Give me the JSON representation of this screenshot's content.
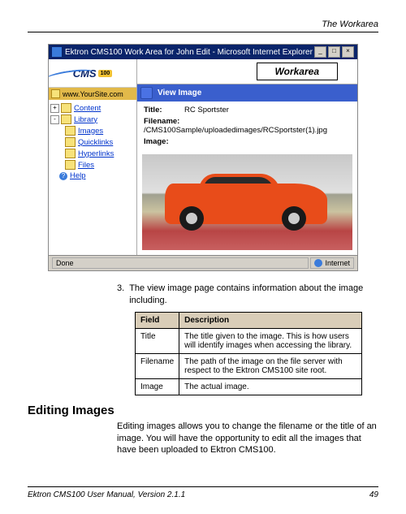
{
  "header": {
    "running": "The Workarea"
  },
  "browser": {
    "title": "Ektron CMS100 Work Area for John Edit - Microsoft Internet Explorer",
    "min": "_",
    "max": "□",
    "close": "×",
    "logo_text": "CMS",
    "logo_badge": "100",
    "site_label": "www.YourSite.com",
    "tree": {
      "content": "Content",
      "library": "Library",
      "images": "Images",
      "quicklinks": "Quicklinks",
      "hyperlinks": "Hyperlinks",
      "files": "Files",
      "help": "Help"
    },
    "workarea_label": "Workarea",
    "viewbar": "View Image",
    "details": {
      "title_label": "Title:",
      "title_value": "RC Sportster",
      "filename_label": "Filename:",
      "filename_value": "/CMS100Sample/uploadedimages/RCSportster(1).jpg",
      "image_label": "Image:"
    },
    "status_done": "Done",
    "status_zone": "Internet"
  },
  "step": {
    "num": "3.",
    "text": "The view image page contains information about the image including."
  },
  "table": {
    "h1": "Field",
    "h2": "Description",
    "rows": [
      {
        "f": "Title",
        "d": "The title given to the image. This is how users will identify images when accessing the library."
      },
      {
        "f": "Filename",
        "d": "The path of the image on the file server with respect to the Ektron CMS100 site root."
      },
      {
        "f": "Image",
        "d": "The actual image."
      }
    ]
  },
  "section": {
    "heading": "Editing Images",
    "body": "Editing images allows you to change the filename or the title of an image.  You will have the opportunity to edit all the images that have been uploaded to Ektron CMS100."
  },
  "footer": {
    "left": "Ektron CMS100 User Manual, Version 2.1.1",
    "right": "49"
  }
}
